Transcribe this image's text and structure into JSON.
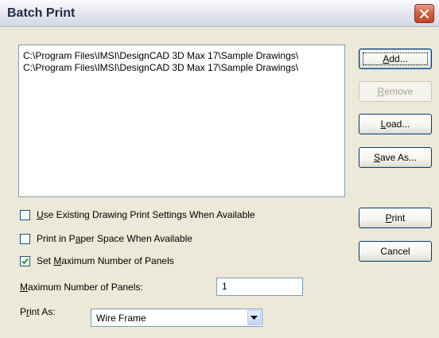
{
  "window": {
    "title": "Batch Print"
  },
  "file_list": {
    "items": [
      "C:\\Program Files\\IMSI\\DesignCAD 3D Max 17\\Sample Drawings\\",
      "C:\\Program Files\\IMSI\\DesignCAD 3D Max 17\\Sample Drawings\\"
    ]
  },
  "buttons": {
    "add": {
      "mnemonic": "A",
      "rest": "dd..."
    },
    "remove": {
      "mnemonic": "R",
      "rest": "emove"
    },
    "load": {
      "mnemonic": "L",
      "rest": "oad..."
    },
    "save_as": {
      "mnemonic": "S",
      "rest": "ave As..."
    },
    "print": {
      "mnemonic": "P",
      "rest": "rint"
    },
    "cancel": {
      "label": "Cancel"
    }
  },
  "options": {
    "use_existing": {
      "mnemonic": "U",
      "rest": "se Existing Drawing Print Settings When Available",
      "checked": false
    },
    "paper_space": {
      "pre": "Print in P",
      "mnemonic": "a",
      "rest": "per Space When Available",
      "checked": false
    },
    "max_panels": {
      "pre": "Set ",
      "mnemonic": "M",
      "rest": "aximum Number of Panels",
      "checked": true
    }
  },
  "max_panels_field": {
    "mnemonic": "M",
    "rest": "aximum Number of Panels:",
    "value": "1"
  },
  "print_as": {
    "pre": "P",
    "mnemonic": "r",
    "rest": "int As:",
    "selected": "Wire Frame"
  },
  "colors": {
    "close_button": "#d15b3e",
    "dialog_bg": "#ece9d8",
    "input_border": "#7f9db9"
  }
}
